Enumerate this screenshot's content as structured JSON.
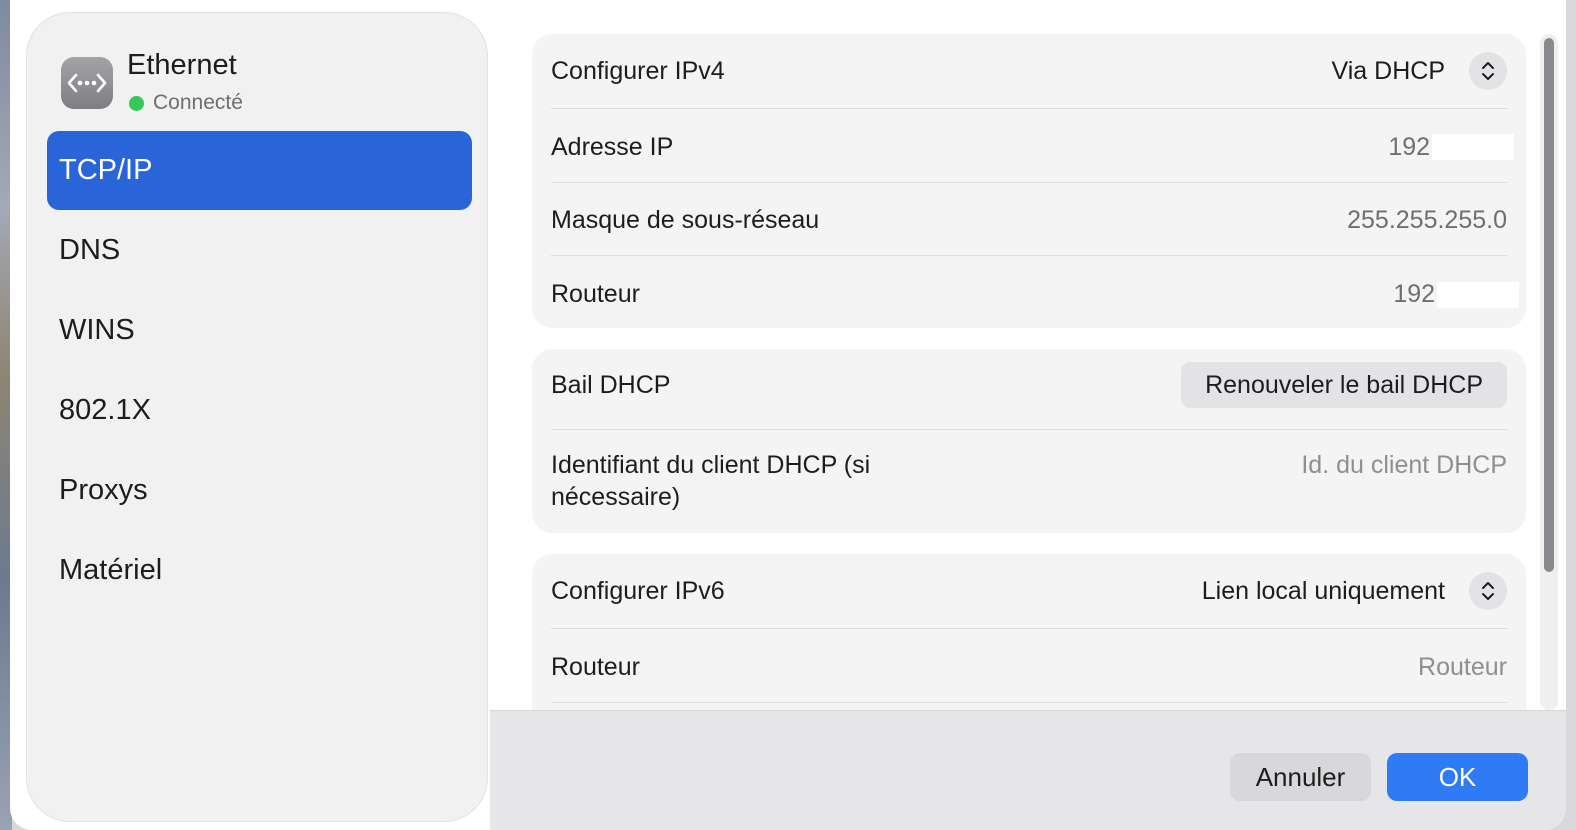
{
  "sidebar": {
    "icon": "ethernet-arrows-icon",
    "title": "Ethernet",
    "status": "Connecté",
    "status_color": "#34c759",
    "items": [
      {
        "label": "TCP/IP",
        "active": true
      },
      {
        "label": "DNS"
      },
      {
        "label": "WINS"
      },
      {
        "label": "802.1X"
      },
      {
        "label": "Proxys"
      },
      {
        "label": "Matériel"
      }
    ]
  },
  "ipv4": {
    "configure_label": "Configurer IPv4",
    "configure_value": "Via DHCP",
    "ip_label": "Adresse IP",
    "ip_value": "192.",
    "mask_label": "Masque de sous-réseau",
    "mask_value": "255.255.255.0",
    "router_label": "Routeur",
    "router_value": "192."
  },
  "dhcp": {
    "lease_label": "Bail DHCP",
    "renew_button": "Renouveler le bail DHCP",
    "client_id_label_line1": "Identifiant du client DHCP (si",
    "client_id_label_line2": "nécessaire)",
    "client_id_placeholder": "Id. du client DHCP"
  },
  "ipv6": {
    "configure_label": "Configurer IPv6",
    "configure_value": "Lien local uniquement",
    "router_label": "Routeur",
    "router_placeholder": "Routeur"
  },
  "footer": {
    "cancel": "Annuler",
    "ok": "OK"
  },
  "colors": {
    "accent": "#2a64d9",
    "ok_button": "#2f7bf5"
  }
}
